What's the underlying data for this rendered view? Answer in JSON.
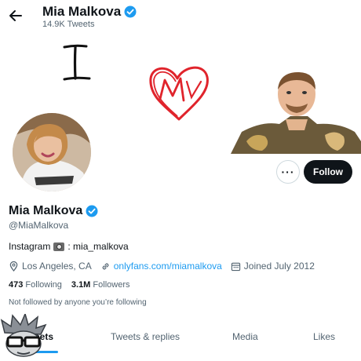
{
  "header": {
    "name": "Mia Malkova",
    "tweet_count": "14.9K Tweets"
  },
  "banner": {
    "handwriting": "I",
    "heart_initials": "M"
  },
  "actions": {
    "more_label": "···",
    "follow_label": "Follow"
  },
  "profile": {
    "name": "Mia Malkova",
    "handle": "@MiaMalkova",
    "bio_prefix": "Instagram",
    "bio_suffix": ": mia_malkova",
    "location": "Los Angeles, CA",
    "website": "onlyfans.com/miamalkova",
    "joined": "Joined July 2012",
    "following_count": "473",
    "following_label": "Following",
    "followers_count": "3.1M",
    "followers_label": "Followers",
    "not_followed": "Not followed by anyone you’re following"
  },
  "tabs": [
    {
      "label": "eets"
    },
    {
      "label": "Tweets & replies"
    },
    {
      "label": "Media"
    },
    {
      "label": "Likes"
    }
  ],
  "colors": {
    "accent": "#1d9bf0",
    "text": "#0f1419",
    "muted": "#536471",
    "heart": "#e0242c"
  }
}
